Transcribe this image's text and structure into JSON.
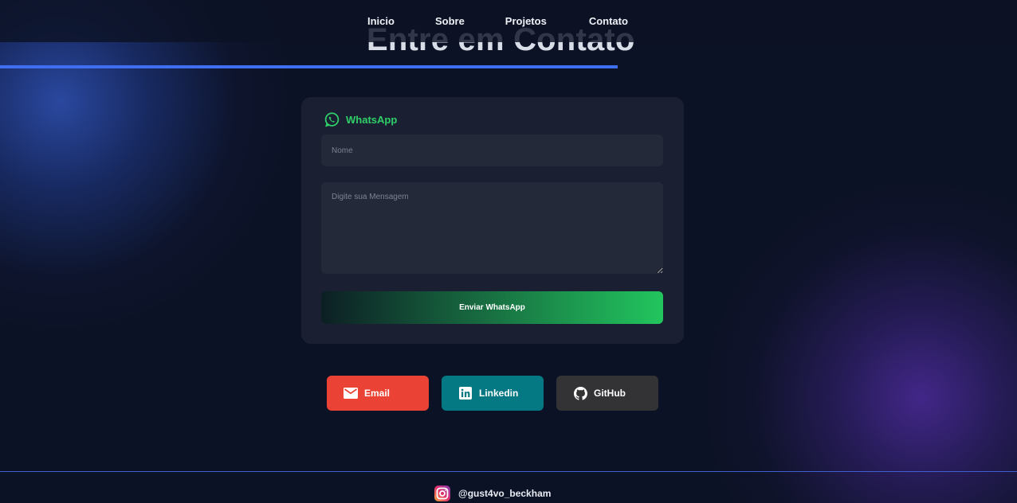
{
  "nav": {
    "links": [
      "Inicio",
      "Sobre",
      "Projetos",
      "Contato"
    ]
  },
  "section": {
    "title": "Entre em Contato"
  },
  "whatsapp_form": {
    "title": "WhatsApp",
    "name_placeholder": "Nome",
    "message_placeholder": "Digite sua Mensagem",
    "submit_label": "Enviar WhatsApp"
  },
  "social_buttons": [
    {
      "label": "Email",
      "icon": "mail-icon",
      "color": "#ea4335"
    },
    {
      "label": "Linkedin",
      "icon": "linkedin-icon",
      "color": "#047883"
    },
    {
      "label": "GitHub",
      "icon": "github-icon",
      "color": "#333335"
    }
  ],
  "footer": {
    "handle": "@gust4vo_beckham",
    "icon": "instagram-icon"
  },
  "colors": {
    "background": "#0c1225",
    "card": "#1a2031",
    "accent_blue": "#3f6ff0",
    "whatsapp_green": "#22c55e"
  }
}
